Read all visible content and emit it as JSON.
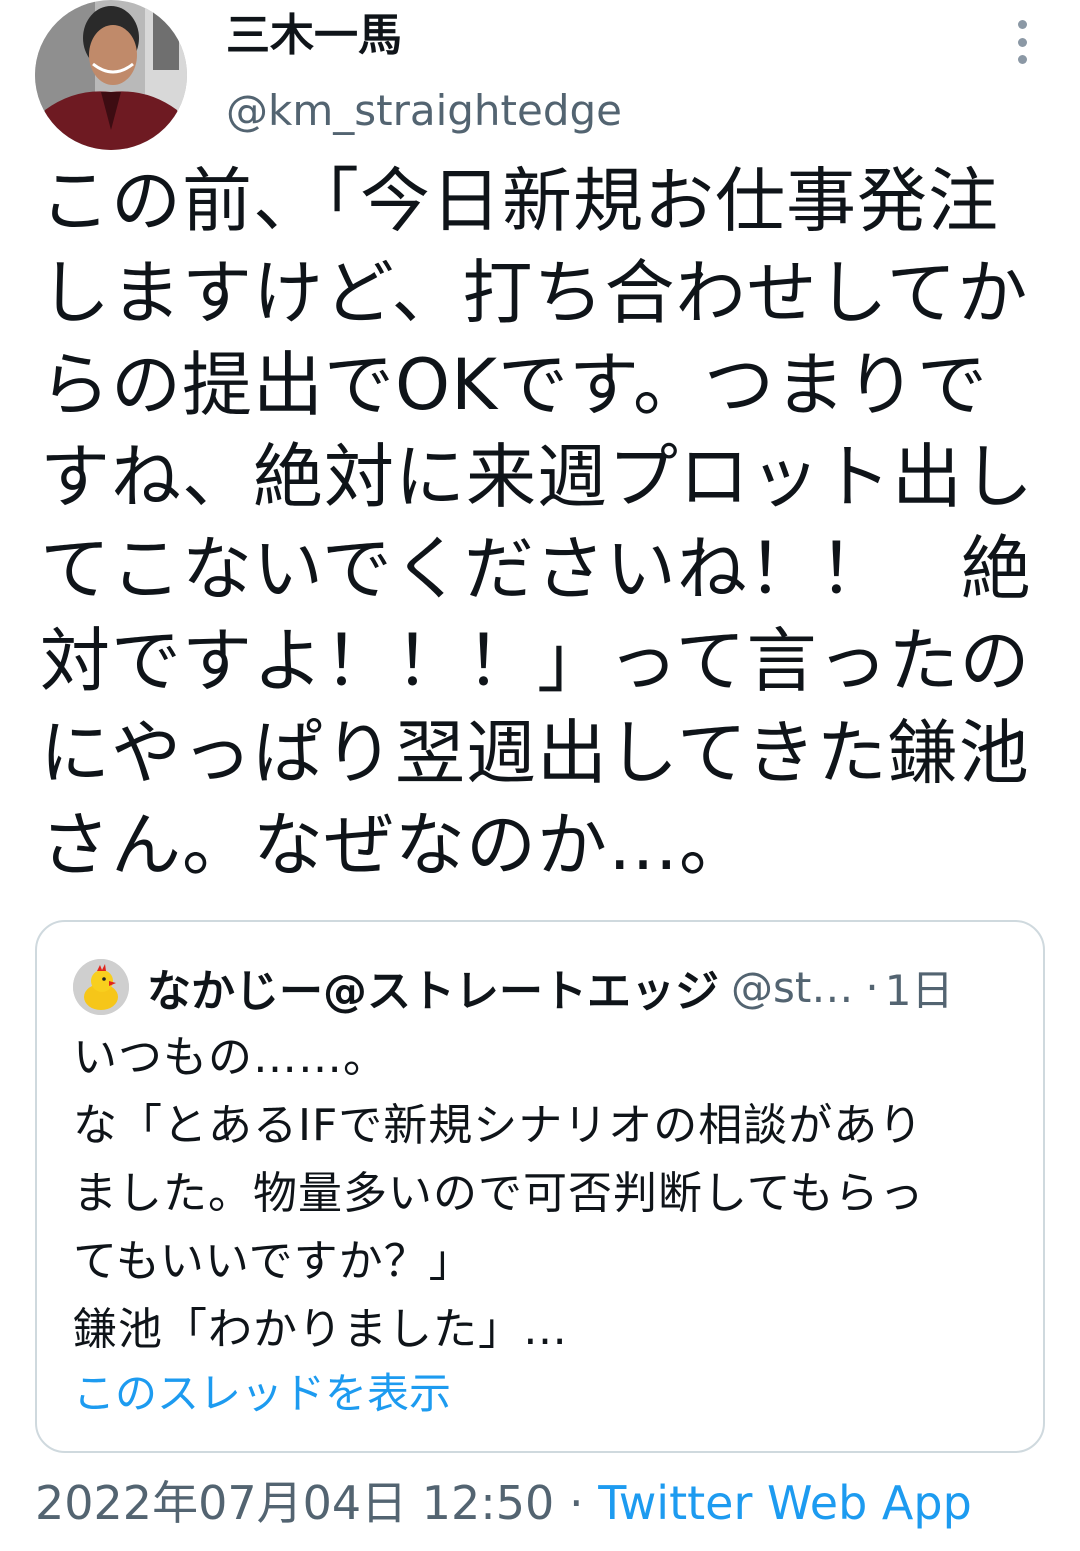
{
  "author": {
    "display_name": "三木一馬",
    "handle": "@km_straightedge"
  },
  "tweet": {
    "lines": [
      "この前、「今日新規お仕事発注",
      "しますけど、打ち合わせしてか",
      "らの提出でOKです。つまりで",
      "すね、絶対に来週プロット出し",
      "てこないでくださいね！！　絶",
      "対ですよ！！！」って言ったの",
      "にやっぱり翌週出してきた鎌池",
      "さん。なぜなのか…。"
    ]
  },
  "quote": {
    "display_name": "なかじー@ストレートエッジ",
    "handle": "@st…",
    "separator": "·",
    "time": "1日",
    "lines": [
      "いつもの……。",
      "な「とあるIFで新規シナリオの相談があり",
      "ました。物量多いので可否判断してもらっ",
      "てもいいですか？」",
      "鎌池「わかりました」…"
    ],
    "show_thread": "このスレッドを表示"
  },
  "meta": {
    "timestamp": "2022年07月04日 12:50",
    "separator": " · ",
    "source": "Twitter Web App"
  },
  "icons": {
    "more": "more-vertical-icon",
    "avatar": "profile-photo",
    "quote_avatar": "chick-toy-avatar"
  },
  "colors": {
    "link": "#1d9bf0",
    "secondary_text": "#536471",
    "border": "#cfd9de"
  }
}
